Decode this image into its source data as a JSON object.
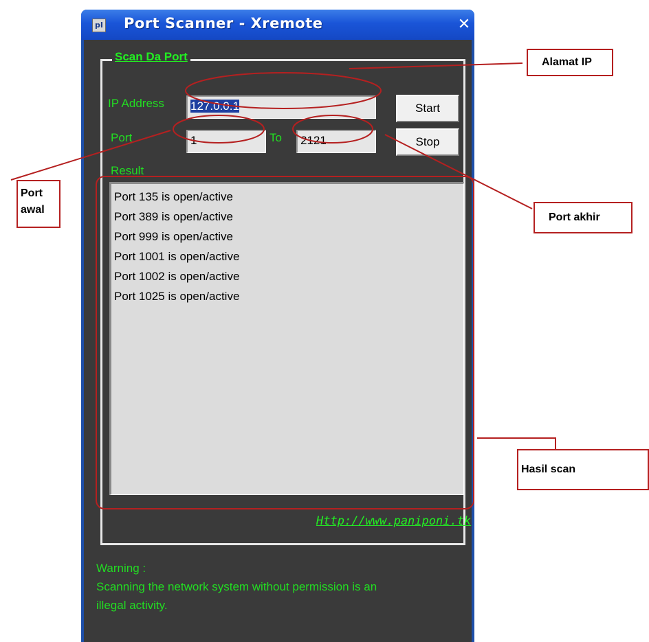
{
  "window": {
    "title": "Port Scanner - Xremote",
    "close_symbol": "✕",
    "icon": "app-icon"
  },
  "scan_group": {
    "title": "Scan Da Port",
    "ip_label": "IP Address",
    "ip_value": "127.0.0.1",
    "port_label": "Port",
    "port_from": "1",
    "to_label": "To",
    "port_to": "2121",
    "start_label": "Start",
    "stop_label": "Stop",
    "result_label": "Result",
    "results": [
      "Port 135 is open/active",
      "Port 389 is open/active",
      "Port 999 is open/active",
      "Port 1001 is open/active",
      "Port 1002 is open/active",
      "Port 1025 is open/active"
    ],
    "link": "Http://www.paniponi.tk"
  },
  "warning": {
    "title": "Warning :",
    "line1": "Scanning the network system without permission is an",
    "line2": "illegal activity."
  },
  "annotations": {
    "alamat_ip": "Alamat IP",
    "port_awal_1": "Port",
    "port_awal_2": "awal",
    "port_akhir": "Port akhir",
    "hasil_scan": "Hasil scan"
  },
  "colors": {
    "text_green": "#22dd22",
    "annotation_red": "#b52020",
    "titlebar_blue": "#1a55d8",
    "window_bg": "#3a3a3a"
  }
}
